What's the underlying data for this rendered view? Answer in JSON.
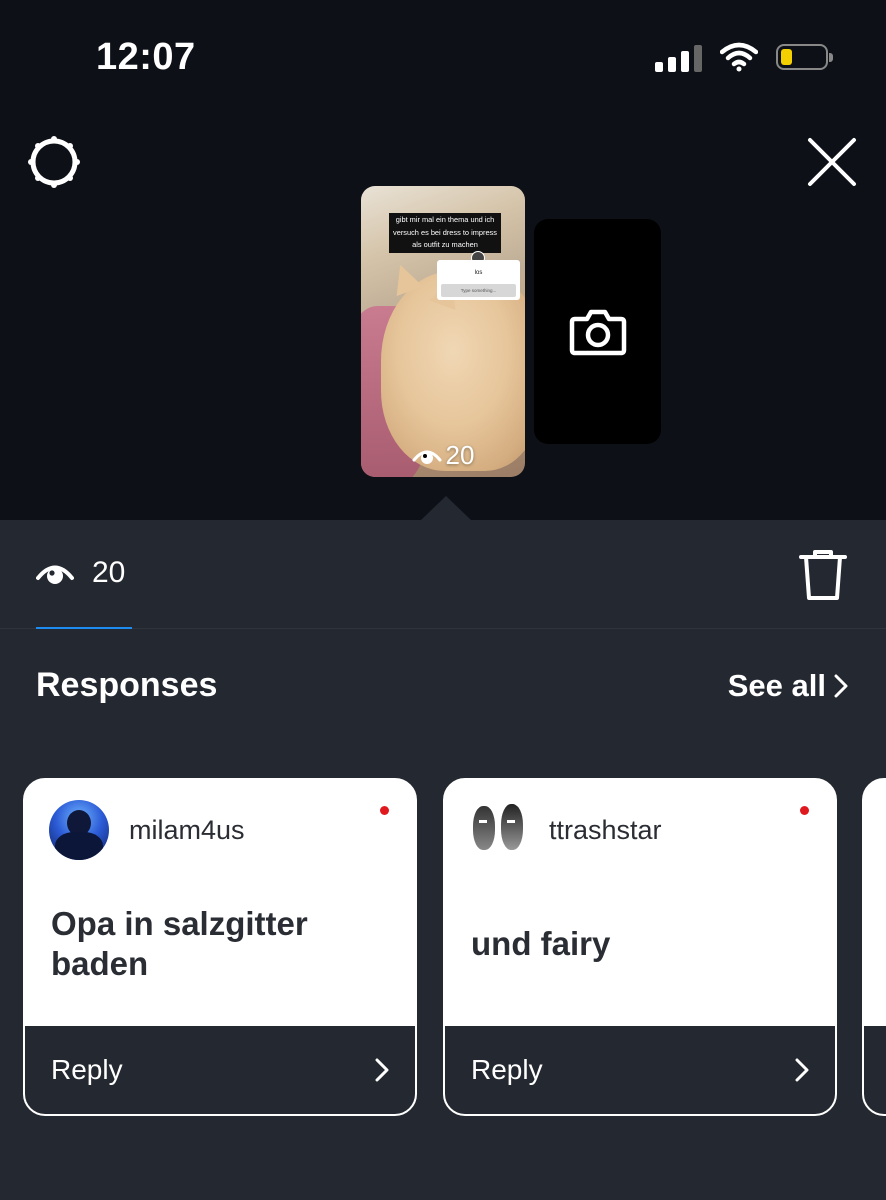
{
  "status_bar": {
    "time": "12:07",
    "battery_level": 0.2
  },
  "icons": {
    "settings": "gear-icon",
    "close": "close-icon",
    "camera": "camera-icon",
    "eye": "eye-icon",
    "trash": "trash-icon",
    "chevron": "chevron-right-icon"
  },
  "story_thumb": {
    "caption": "gibt mir mal ein thema und ich versuch es bei dress to impress als outfit zu machen",
    "question": "los",
    "answer_placeholder": "Type something...",
    "views": "20"
  },
  "viewers_tab": {
    "count": "20"
  },
  "responses": {
    "title": "Responses",
    "see_all": "See all",
    "items": [
      {
        "username": "milam4us",
        "text": "Opa in salzgitter baden",
        "reply_label": "Reply",
        "unread": true
      },
      {
        "username": "ttrashstar",
        "text": "und fairy",
        "reply_label": "Reply",
        "unread": true
      }
    ]
  },
  "colors": {
    "accent": "#1d8bf0",
    "unread_dot": "#e0191f",
    "battery": "#f5d000"
  }
}
